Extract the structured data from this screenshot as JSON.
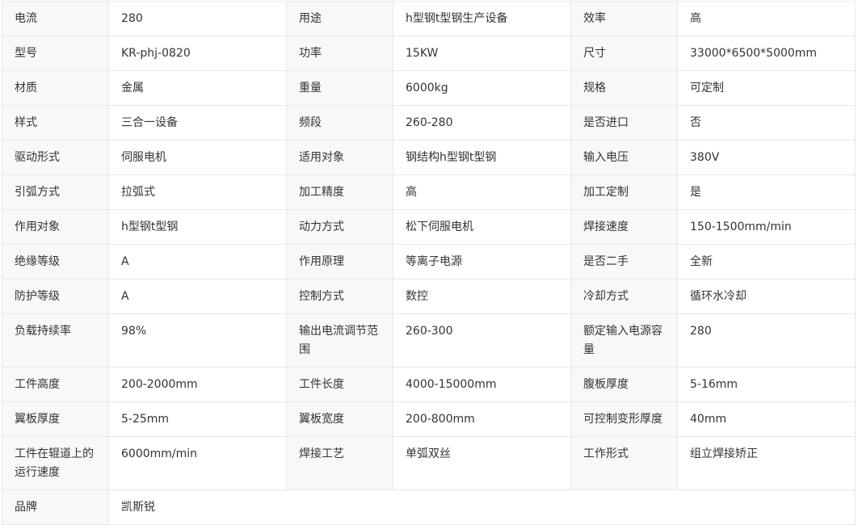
{
  "rows": [
    [
      [
        "电流",
        "280"
      ],
      [
        "用途",
        "h型钢t型钢生产设备"
      ],
      [
        "效率",
        "高"
      ]
    ],
    [
      [
        "型号",
        "KR-phj-0820"
      ],
      [
        "功率",
        "15KW"
      ],
      [
        "尺寸",
        "33000*6500*5000mm"
      ]
    ],
    [
      [
        "材质",
        "金属"
      ],
      [
        "重量",
        "6000kg"
      ],
      [
        "规格",
        "可定制"
      ]
    ],
    [
      [
        "样式",
        "三合一设备"
      ],
      [
        "频段",
        "260-280"
      ],
      [
        "是否进口",
        "否"
      ]
    ],
    [
      [
        "驱动形式",
        "伺服电机"
      ],
      [
        "适用对象",
        "钢结构h型钢t型钢"
      ],
      [
        "输入电压",
        "380V"
      ]
    ],
    [
      [
        "引弧方式",
        "拉弧式"
      ],
      [
        "加工精度",
        "高"
      ],
      [
        "加工定制",
        "是"
      ]
    ],
    [
      [
        "作用对象",
        "h型钢t型钢"
      ],
      [
        "动力方式",
        "松下伺服电机"
      ],
      [
        "焊接速度",
        "150-1500mm/min"
      ]
    ],
    [
      [
        "绝缘等级",
        "A"
      ],
      [
        "作用原理",
        "等离子电源"
      ],
      [
        "是否二手",
        "全新"
      ]
    ],
    [
      [
        "防护等级",
        "A"
      ],
      [
        "控制方式",
        "数控"
      ],
      [
        "冷却方式",
        "循环水冷却"
      ]
    ],
    [
      [
        "负载持续率",
        "98%"
      ],
      [
        "输出电流调节范围",
        "260-300"
      ],
      [
        "额定输入电源容量",
        "280"
      ]
    ],
    [
      [
        "工件高度",
        "200-2000mm"
      ],
      [
        "工件长度",
        "4000-15000mm"
      ],
      [
        "腹板厚度",
        "5-16mm"
      ]
    ],
    [
      [
        "翼板厚度",
        "5-25mm"
      ],
      [
        "翼板宽度",
        "200-800mm"
      ],
      [
        "可控制变形厚度",
        "40mm"
      ]
    ],
    [
      [
        "工件在辊道上的运行速度",
        "6000mm/min"
      ],
      [
        "焊接工艺",
        "单弧双丝"
      ],
      [
        "工作形式",
        "组立焊接矫正"
      ]
    ],
    [
      [
        "品牌",
        "凯斯锐"
      ]
    ]
  ]
}
